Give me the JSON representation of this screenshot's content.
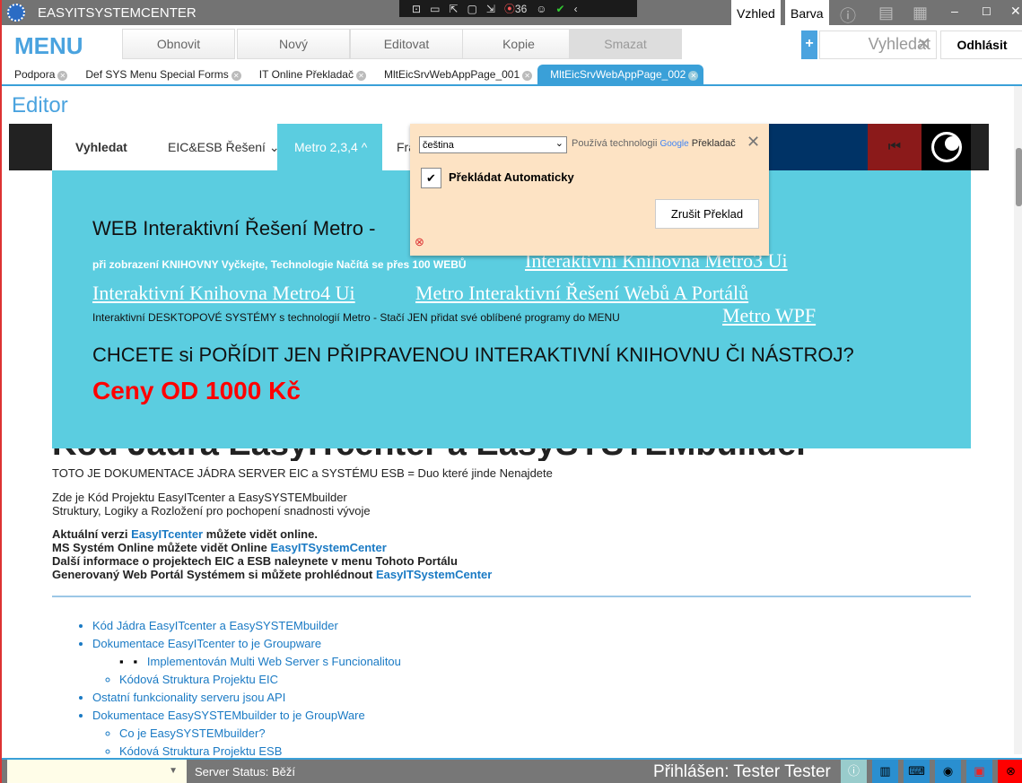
{
  "app": {
    "title": "EASYITSYSTEMCENTER",
    "appearance": "Vzhled",
    "color": "Barva",
    "dev_badge": "36"
  },
  "toolbar": {
    "menu": "MENU",
    "buttons": [
      "Obnovit",
      "Nový",
      "Editovat",
      "Kopie",
      "Smazat"
    ],
    "plus": "+",
    "search_placeholder": "Vyhledat",
    "logout": "Odhlásit"
  },
  "tabs": [
    "Podpora",
    "Def SYS Menu Special Forms",
    "IT Online Překladač",
    "MltEicSrvWebAppPage_001",
    "MltEicSrvWebAppPage_002"
  ],
  "editor_label": "Editor",
  "nav": {
    "search": "Vyhledat",
    "eic": "EIC&ESB Řešení ⌄",
    "metro": "Metro 2,3,4 ^",
    "fra": "Fra"
  },
  "translate": {
    "language": "čeština",
    "powered": "Používá technologii",
    "google": "Google",
    "translator": "Překladač",
    "auto": "Překládat Automaticky",
    "cancel": "Zrušit Překlad"
  },
  "hero": {
    "title": "WEB Interaktivní Řešení Metro - ",
    "loading": "při zobrazení KNIHOVNY Vyčkejte, Technologie Načítá se přes 100 WEBŮ",
    "link1": "Interaktivní Knihovna Metro3 Ui",
    "link2": "Interaktivní Knihovna Metro4 Ui",
    "link3": "Metro Interaktivní Řešení Webů A Portálů",
    "desktop": "Interaktivní DESKTOPOVÉ SYSTÉMY s technologií Metro - Stačí JEN přidat své oblíbené programy do MENU",
    "link4": "Metro WPF",
    "question": "CHCETE si POŘÍDIT JEN PŘIPRAVENOU INTERAKTIVNÍ KNIHOVNU ČI NÁSTROJ?",
    "price": "Ceny OD 1000 Kč"
  },
  "content": {
    "heading": "Kód Jádra EasyITcenter a EasySYSTEMbuilder",
    "intro": "TOTO JE DOKUMENTACE JÁDRA SERVER EIC a SYSTÉMU ESB = Duo které jinde Nenajdete",
    "p1": "Zde je Kód Projektu EasyITcenter a EasySYSTEMbuilder",
    "p2": "Struktury, Logiky a Rozložení pro pochopení snadnosti vývoje",
    "b1a": "Aktuální verzi ",
    "b1l": "EasyITcenter",
    "b1b": " můžete vidět online.",
    "b2a": "MS Systém Online můžete vidět Online ",
    "b2l": "EasyITSystemCenter",
    "b3": "Další informace o projektech EIC a ESB naleynete v menu Tohoto Portálu",
    "b4a": "Generovaný Web Portál Systémem si můžete prohlédnout ",
    "b4l": "EasyITSystemCenter"
  },
  "list": {
    "i1": "Kód Jádra EasyITcenter a EasySYSTEMbuilder",
    "i2": "Dokumentace EasyITcenter to je Groupware",
    "i2a": "Implementován Multi Web Server s Funcionalitou",
    "i2b": "Kódová Struktura Projektu EIC",
    "i3": "Ostatní funkcionality serveru jsou API",
    "i4": "Dokumentace EasySYSTEMbuilder to je GroupWare",
    "i4a": "Co je EasySYSTEMbuilder?",
    "i4b": "Kódová Struktura Projektu ESB"
  },
  "status": {
    "server": "Server Status:  Běží",
    "logged": "Přihlášen: Tester Tester"
  }
}
